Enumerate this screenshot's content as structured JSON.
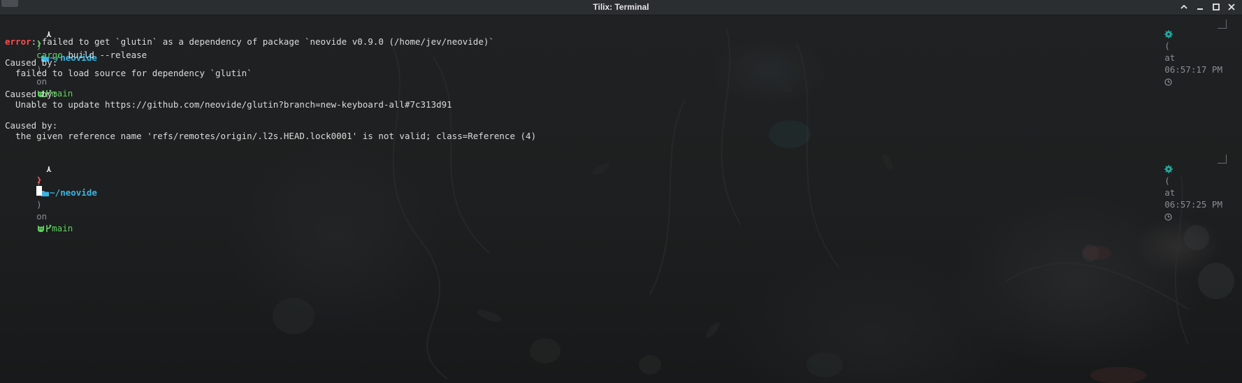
{
  "window": {
    "title": "Tilix: Terminal"
  },
  "prompt1": {
    "arch_glyph": "⋏",
    "sep1": ")",
    "path": "~/neovide",
    "sep2": ")",
    "on": "on",
    "branch": "main",
    "status_open": "(",
    "status_at": "at",
    "time": "06:57:17 PM"
  },
  "command": {
    "prompt_char": "❯",
    "cmd": "cargo",
    "args": " build --release"
  },
  "output": {
    "error_label": "error",
    "error_msg": ": failed to get `glutin` as a dependency of package `neovide v0.9.0 (/home/jev/neovide)`",
    "caused_1_label": "Caused by:",
    "caused_1_msg": "  failed to load source for dependency `glutin`",
    "caused_2_label": "Caused by:",
    "caused_2_msg": "  Unable to update https://github.com/neovide/glutin?branch=new-keyboard-all#7c313d91",
    "caused_3_label": "Caused by:",
    "caused_3_msg": "  the given reference name 'refs/remotes/origin/.l2s.HEAD.lock0001' is not valid; class=Reference (4)"
  },
  "prompt2": {
    "arch_glyph": "⋏",
    "sep1": ")",
    "path": "~/neovide",
    "sep2": ")",
    "on": "on",
    "branch": "main",
    "status_open": "(",
    "status_at": "at",
    "time": "06:57:25 PM",
    "prompt_char": "❯"
  },
  "colors": {
    "error": "#ff4d4d",
    "path": "#3ab4e2",
    "git": "#5fd35f",
    "status_icon": "#24a8a0"
  },
  "icons": {
    "folder": "folder-icon",
    "git_cat": "github-cat-icon",
    "branch": "git-branch-icon",
    "gear": "gear-icon",
    "clock": "clock-icon"
  }
}
